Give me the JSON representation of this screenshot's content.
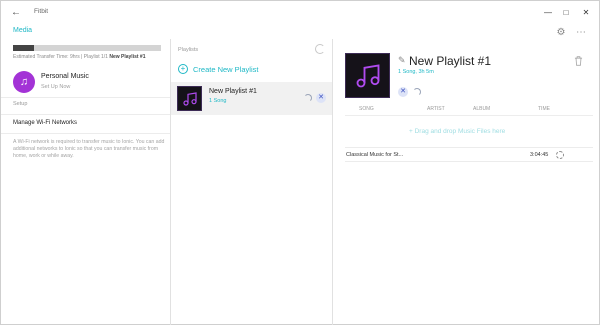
{
  "window": {
    "title": "Fitbit",
    "back_icon": "arrow-left-icon",
    "minimize_icon": "minimize-icon",
    "maximize_icon": "maximize-icon",
    "close_icon": "close-icon"
  },
  "header": {
    "section": "Media",
    "settings_icon": "gear-icon",
    "more_icon": "more-icon"
  },
  "sidebar": {
    "transfer": {
      "progress": 0.14,
      "label_prefix": "Estimated Transfer Time: 9hrs | Playlist 1/1",
      "label_playlist": "New Playlist #1"
    },
    "personal_music": {
      "title": "Personal Music",
      "subtitle": "Set Up Now"
    },
    "setup_heading": "Setup",
    "wifi_label": "Manage Wi-Fi Networks",
    "wifi_description": "A Wi-Fi network is required to transfer music to Ionic. You can add additional networks to Ionic so that you can transfer music from home, work or while away."
  },
  "playlists": {
    "heading": "Playlists",
    "create_label": "Create New Playlist",
    "items": [
      {
        "name": "New Playlist #1",
        "count": "1 Song"
      }
    ]
  },
  "detail": {
    "title": "New Playlist #1",
    "meta": "1 Song, 3h 5m",
    "columns": {
      "song": "SONG",
      "artist": "ARTIST",
      "album": "ALBUM",
      "time": "TIME"
    },
    "drop_hint": "+ Drag and drop Music Files here",
    "tracks": [
      {
        "title": "Classical Music for St...",
        "time": "3:04:45"
      }
    ],
    "accent": "#1fb8c6",
    "brand_purple": "#a333d6"
  }
}
